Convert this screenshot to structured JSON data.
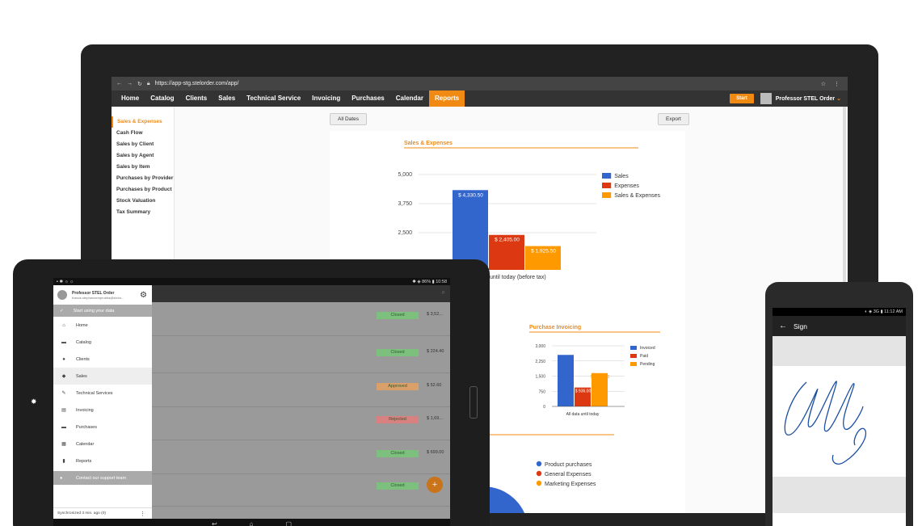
{
  "laptop": {
    "browser": {
      "url": "https://app-stg.stelorder.com/app/"
    },
    "nav": {
      "items": [
        "Home",
        "Catalog",
        "Clients",
        "Sales",
        "Technical Service",
        "Invoicing",
        "Purchases",
        "Calendar",
        "Reports"
      ],
      "active_index": 8,
      "start_label": "Start",
      "user_label": "Professor STEL Order"
    },
    "sidebar": [
      "Sales & Expenses",
      "Cash Flow",
      "Sales by Client",
      "Sales by Agent",
      "Sales by Item",
      "Purchases by Provider",
      "Purchases by Product",
      "Stock Valuation",
      "Tax Summary"
    ],
    "sidebar_active_index": 0,
    "all_dates_label": "All Dates",
    "export_label": "Export",
    "colors": {
      "accent": "#f08a12",
      "sales": "#3366cc",
      "expenses": "#dc3912",
      "balance": "#ff9900",
      "blue_invoiced": "#3366cc",
      "red_paid": "#dc3912",
      "orange_pending": "#ff9900"
    }
  },
  "chart_data": [
    {
      "type": "bar",
      "title": "Sales & Expenses",
      "categories": [
        "until today (before tax)"
      ],
      "series": [
        {
          "name": "Sales",
          "values": [
            4330.5
          ],
          "label": "$ 4,330.50"
        },
        {
          "name": "Expenses",
          "values": [
            2405.0
          ],
          "label": "$ 2,405.00"
        },
        {
          "name": "Sales & Expenses",
          "values": [
            1925.5
          ],
          "label": "$ 1,925.50"
        }
      ],
      "ylim": [
        0,
        5000
      ],
      "yticks": [
        "5,000",
        "3,750",
        "2,500"
      ],
      "legend": "right",
      "grid": true
    },
    {
      "type": "bar",
      "title": "Purchase Invoicing",
      "categories": [
        "All data until today"
      ],
      "series": [
        {
          "name": "Invoiced",
          "values": [
            2550
          ],
          "label": ""
        },
        {
          "name": "Paid",
          "values": [
            936
          ],
          "label": "$ 936.00"
        },
        {
          "name": "Pending",
          "values": [
            1650
          ],
          "label": "$ 1,650.00"
        }
      ],
      "ylim": [
        0,
        3000
      ],
      "yticks": [
        "3,000",
        "2,250",
        "1,500",
        "750",
        "0"
      ],
      "legend": "right",
      "grid": true
    },
    {
      "type": "pie",
      "legend_entries": [
        "Product purchases",
        "General Expenses",
        "Marketing Expenses"
      ],
      "legend": "right"
    }
  ],
  "tablet": {
    "status": {
      "battery": "86%",
      "time": "10:58"
    },
    "drawer": {
      "user_name": "Professor STEL Order",
      "user_email": "francis.stephanoemprueba@stelor...",
      "start_label": "Start using your data",
      "items": [
        {
          "label": "Home",
          "icon": "home-icon",
          "glyph": "⌂"
        },
        {
          "label": "Catalog",
          "icon": "catalog-icon",
          "glyph": "▬"
        },
        {
          "label": "Clients",
          "icon": "clients-icon",
          "glyph": "●"
        },
        {
          "label": "Sales",
          "icon": "tag-icon",
          "glyph": "◆"
        },
        {
          "label": "Technical Services",
          "icon": "wrench-icon",
          "glyph": "✎"
        },
        {
          "label": "Invoicing",
          "icon": "document-icon",
          "glyph": "▤"
        },
        {
          "label": "Purchases",
          "icon": "purchases-icon",
          "glyph": "▬"
        },
        {
          "label": "Calendar",
          "icon": "calendar-icon",
          "glyph": "▦"
        },
        {
          "label": "Reports",
          "icon": "bar-chart-icon",
          "glyph": "▮"
        }
      ],
      "active_index": 3,
      "support_label": "Contact our support team",
      "sync_label": "Synchronized 3 min. ago (0)"
    },
    "rows": [
      {
        "status": "Closed",
        "amount": "$ 3,52...",
        "color": "#7dbf7d"
      },
      {
        "status": "Closed",
        "amount": "$ 224.40",
        "color": "#7dbf7d"
      },
      {
        "status": "Approved",
        "amount": "$ 52.60",
        "color": "#d9a06a"
      },
      {
        "status": "Rejected",
        "amount": "$ 1,69...",
        "color": "#d98080"
      },
      {
        "status": "Closed",
        "amount": "$ 699.00",
        "color": "#7dbf7d"
      },
      {
        "status": "Closed",
        "amount": "$ 1,45...",
        "color": "#7dbf7d"
      }
    ]
  },
  "phone": {
    "status": {
      "network": "3G",
      "time": "11:12 AM"
    },
    "title": "Sign"
  }
}
